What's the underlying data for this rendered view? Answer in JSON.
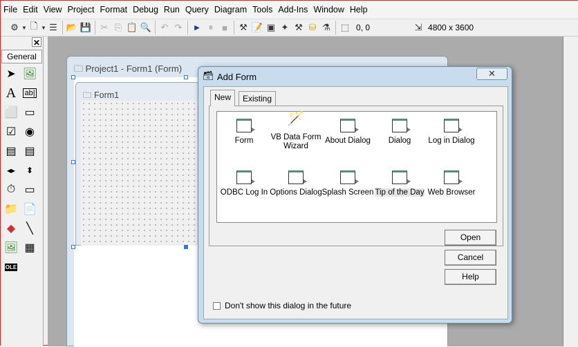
{
  "menu": [
    "File",
    "Edit",
    "View",
    "Project",
    "Format",
    "Debug",
    "Run",
    "Query",
    "Diagram",
    "Tools",
    "Add-Ins",
    "Window",
    "Help"
  ],
  "toolbar": {
    "position": "0, 0",
    "size": "4800 x 3600"
  },
  "toolbox": {
    "tab": "General",
    "close": "✕"
  },
  "project_window": {
    "title": "Project1 - Form1 (Form)"
  },
  "form": {
    "title": "Form1"
  },
  "dialog": {
    "title": "Add Form",
    "close": "✕",
    "tabs": [
      "New",
      "Existing"
    ],
    "items": [
      {
        "label": "Form",
        "icon": "form-icon"
      },
      {
        "label": "VB Data Form Wizard",
        "icon": "wizard-icon"
      },
      {
        "label": "About Dialog",
        "icon": "form-icon"
      },
      {
        "label": "Dialog",
        "icon": "form-icon"
      },
      {
        "label": "Log in Dialog",
        "icon": "form-icon"
      },
      {
        "label": "ODBC Log In",
        "icon": "form-icon"
      },
      {
        "label": "Options Dialog",
        "icon": "form-icon"
      },
      {
        "label": "Splash Screen",
        "icon": "form-icon"
      },
      {
        "label": "Tip of the Day",
        "icon": "form-icon",
        "selected": true
      },
      {
        "label": "Web Browser",
        "icon": "form-icon"
      }
    ],
    "buttons": {
      "open": "Open",
      "cancel": "Cancel",
      "help": "Help"
    },
    "checkbox": {
      "label": "Don't show this dialog in the future",
      "checked": false
    }
  }
}
